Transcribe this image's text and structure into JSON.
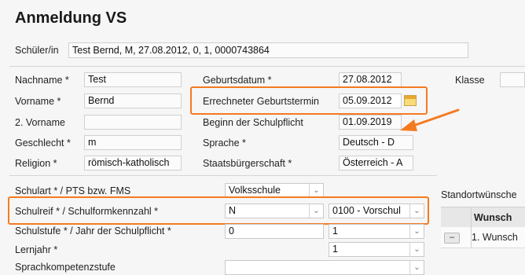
{
  "page_title": "Anmeldung VS",
  "student": {
    "label": "Schüler/in",
    "value": "Test Bernd, M, 27.08.2012, 0, 1, 0000743864"
  },
  "fields": {
    "nachname": {
      "label": "Nachname *",
      "value": "Test"
    },
    "vorname": {
      "label": "Vorname *",
      "value": "Bernd"
    },
    "vorname2": {
      "label": "2. Vorname",
      "value": ""
    },
    "geschlecht": {
      "label": "Geschlecht *",
      "value": "m"
    },
    "religion": {
      "label": "Religion *",
      "value": "römisch-katholisch"
    },
    "geburtsdatum": {
      "label": "Geburtsdatum *",
      "value": "27.08.2012"
    },
    "errechneter": {
      "label": "Errechneter Geburtstermin",
      "value": "05.09.2012"
    },
    "schulpflicht": {
      "label": "Beginn der Schulpflicht",
      "value": "01.09.2019"
    },
    "sprache": {
      "label": "Sprache *",
      "value": "Deutsch - D"
    },
    "staatsbuerger": {
      "label": "Staatsbürgerschaft *",
      "value": "Österreich - A"
    },
    "klasse": {
      "label": "Klasse",
      "value": ""
    }
  },
  "lower": {
    "schulart": {
      "label": "Schulart * / PTS bzw. FMS",
      "value": "Volksschule"
    },
    "schulreif": {
      "label": "Schulreif * / Schulformkennzahl *",
      "value": "N",
      "value2": "0100 - Vorschul"
    },
    "schulstufe": {
      "label": "Schulstufe * / Jahr der Schulpflicht *",
      "value": "0",
      "value2": "1"
    },
    "lernjahr": {
      "label": "Lernjahr *",
      "value": "1"
    },
    "sprachkompetenz": {
      "label": "Sprachkompetenzstufe",
      "value": ""
    }
  },
  "right_panel": {
    "title": "Standortwünsche",
    "col_header": "Wunsch",
    "row1": "1. Wunsch",
    "remove_symbol": "–"
  },
  "icons": {
    "calendar": "calendar-icon",
    "dropdown": "chevron-down-icon",
    "arrow": "arrow-annotation-icon"
  },
  "colors": {
    "highlight": "#f47b20",
    "background": "#f6f6f6"
  }
}
